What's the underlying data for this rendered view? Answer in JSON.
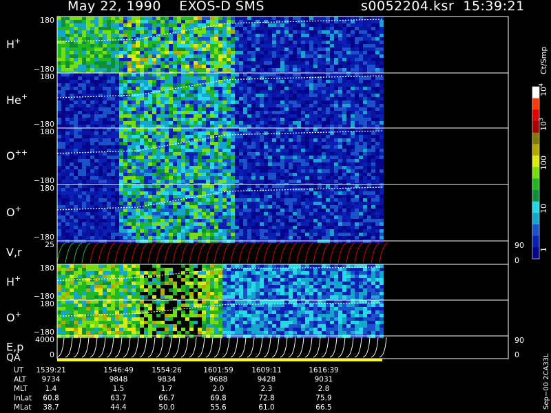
{
  "header": {
    "title": "May 22, 1990    EXOS-D SMS",
    "file_time": "s0052204.ksr  15:39:21"
  },
  "chart_data": {
    "type": "heatmap",
    "panels": [
      {
        "label_base": "H",
        "label_sup": "+",
        "ymax_label": "180",
        "ymin_label": "−180",
        "palette": "std"
      },
      {
        "label_base": "He",
        "label_sup": "+",
        "ymax_label": "180",
        "ymin_label": "−180",
        "palette": "std"
      },
      {
        "label_base": "O",
        "label_sup": "++",
        "ymax_label": "180",
        "ymin_label": "−180",
        "palette": "std"
      },
      {
        "label_base": "O",
        "label_sup": "+",
        "ymax_label": "180",
        "ymin_label": "−180",
        "palette": "std"
      },
      {
        "label_base": "V,r",
        "label_sup": "",
        "ymax_label": "25",
        "ymin_label": "",
        "right_top": "90",
        "right_bottom": "0",
        "palette": "line"
      },
      {
        "label_base": "H",
        "label_sup": "+",
        "ymax_label": "180",
        "ymin_label": "−180",
        "palette": "b"
      },
      {
        "label_base": "O",
        "label_sup": "+",
        "ymax_label": "180",
        "ymin_label": "−180",
        "palette": "b"
      },
      {
        "label_base": "E,p",
        "label_sup": "",
        "ymax_label": "4000",
        "ymin_label": "0",
        "right_top": "90",
        "right_bottom": "0",
        "palette": "curves"
      }
    ],
    "qa_label": "QA",
    "colorbar": {
      "title": "Ct/Smp",
      "labels": [
        "1",
        "10",
        "100",
        "10",
        "10"
      ],
      "sups": [
        "",
        "",
        "",
        "3",
        "4"
      ],
      "colors": [
        "#05058a",
        "#0a1fb4",
        "#1b52c9",
        "#14a6cc",
        "#27d9e6",
        "#0f8f3c",
        "#22b822",
        "#77de10",
        "#dcea10",
        "#b6a800",
        "#7d7d05",
        "#a80000",
        "#e00000",
        "#ff3a00",
        "#ffffff"
      ]
    },
    "footer_table": {
      "rows": [
        {
          "label": "UT",
          "values": [
            "1539:21",
            "1546:49",
            "1554:26",
            "1601:59",
            "1609:11",
            "1616:39"
          ]
        },
        {
          "label": "ALT",
          "values": [
            "9734",
            "9848",
            "9834",
            "9688",
            "9428",
            "9031"
          ]
        },
        {
          "label": "MLT",
          "values": [
            "1.4",
            "1.5",
            "1.7",
            "2.0",
            "2.3",
            "2.8"
          ]
        },
        {
          "label": "InLat",
          "values": [
            "60.8",
            "63.7",
            "66.7",
            "69.8",
            "72.8",
            "75.9"
          ]
        },
        {
          "label": "MLat",
          "values": [
            "38.7",
            "44.4",
            "50.0",
            "55.6",
            "61.0",
            "66.5"
          ]
        }
      ]
    },
    "side_note": "Sep−00  2CA33L"
  }
}
